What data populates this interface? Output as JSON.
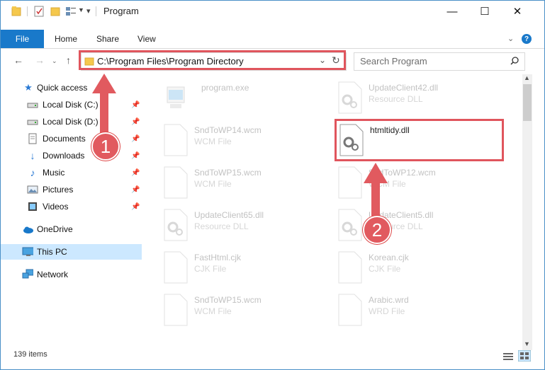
{
  "window": {
    "title": "Program"
  },
  "ribbon": {
    "tabs": [
      "File",
      "Home",
      "Share",
      "View"
    ]
  },
  "address": {
    "path": "C:\\Program Files\\Program Directory"
  },
  "search": {
    "placeholder": "Search Program"
  },
  "nav": {
    "quick_access": "Quick access",
    "items": [
      "Local Disk (C:)",
      "Local Disk (D:)",
      "Documents",
      "Downloads",
      "Music",
      "Pictures",
      "Videos"
    ],
    "onedrive": "OneDrive",
    "this_pc": "This PC",
    "network": "Network"
  },
  "files": [
    {
      "name": "program.exe",
      "type": ""
    },
    {
      "name": "UpdateClient42.dll",
      "type": "Resource DLL"
    },
    {
      "name": "SndToWP14.wcm",
      "type": "WCM File"
    },
    {
      "name": "htmltidy.dll",
      "type": ""
    },
    {
      "name": "SndToWP15.wcm",
      "type": "WCM File"
    },
    {
      "name": "SndToWP12.wcm",
      "type": "WCM File"
    },
    {
      "name": "UpdateClient65.dll",
      "type": "Resource DLL"
    },
    {
      "name": "UpdateClient5.dll",
      "type": "Resource DLL"
    },
    {
      "name": "FastHtml.cjk",
      "type": "CJK File"
    },
    {
      "name": "Korean.cjk",
      "type": "CJK File"
    },
    {
      "name": "SndToWP15.wcm",
      "type": "WCM File"
    },
    {
      "name": "Arabic.wrd",
      "type": "WRD File"
    }
  ],
  "status": {
    "items": "139 items"
  },
  "annotations": {
    "step1": "1",
    "step2": "2"
  },
  "colors": {
    "accent": "#1979ca",
    "highlight": "#e0555d",
    "selection": "#cce8ff"
  },
  "icons": [
    "folder-icon",
    "properties-icon",
    "new-folder-icon",
    "customize-icon",
    "minimize-icon",
    "maximize-icon",
    "close-icon",
    "help-icon",
    "back-icon",
    "forward-icon",
    "up-icon",
    "refresh-icon",
    "search-icon",
    "star-icon",
    "drive-icon",
    "document-icon",
    "download-icon",
    "music-icon",
    "pictures-icon",
    "videos-icon",
    "cloud-icon",
    "computer-icon",
    "network-icon",
    "pin-icon",
    "gear-file-icon",
    "blank-file-icon",
    "exe-icon",
    "details-view-icon",
    "large-icons-view-icon"
  ]
}
